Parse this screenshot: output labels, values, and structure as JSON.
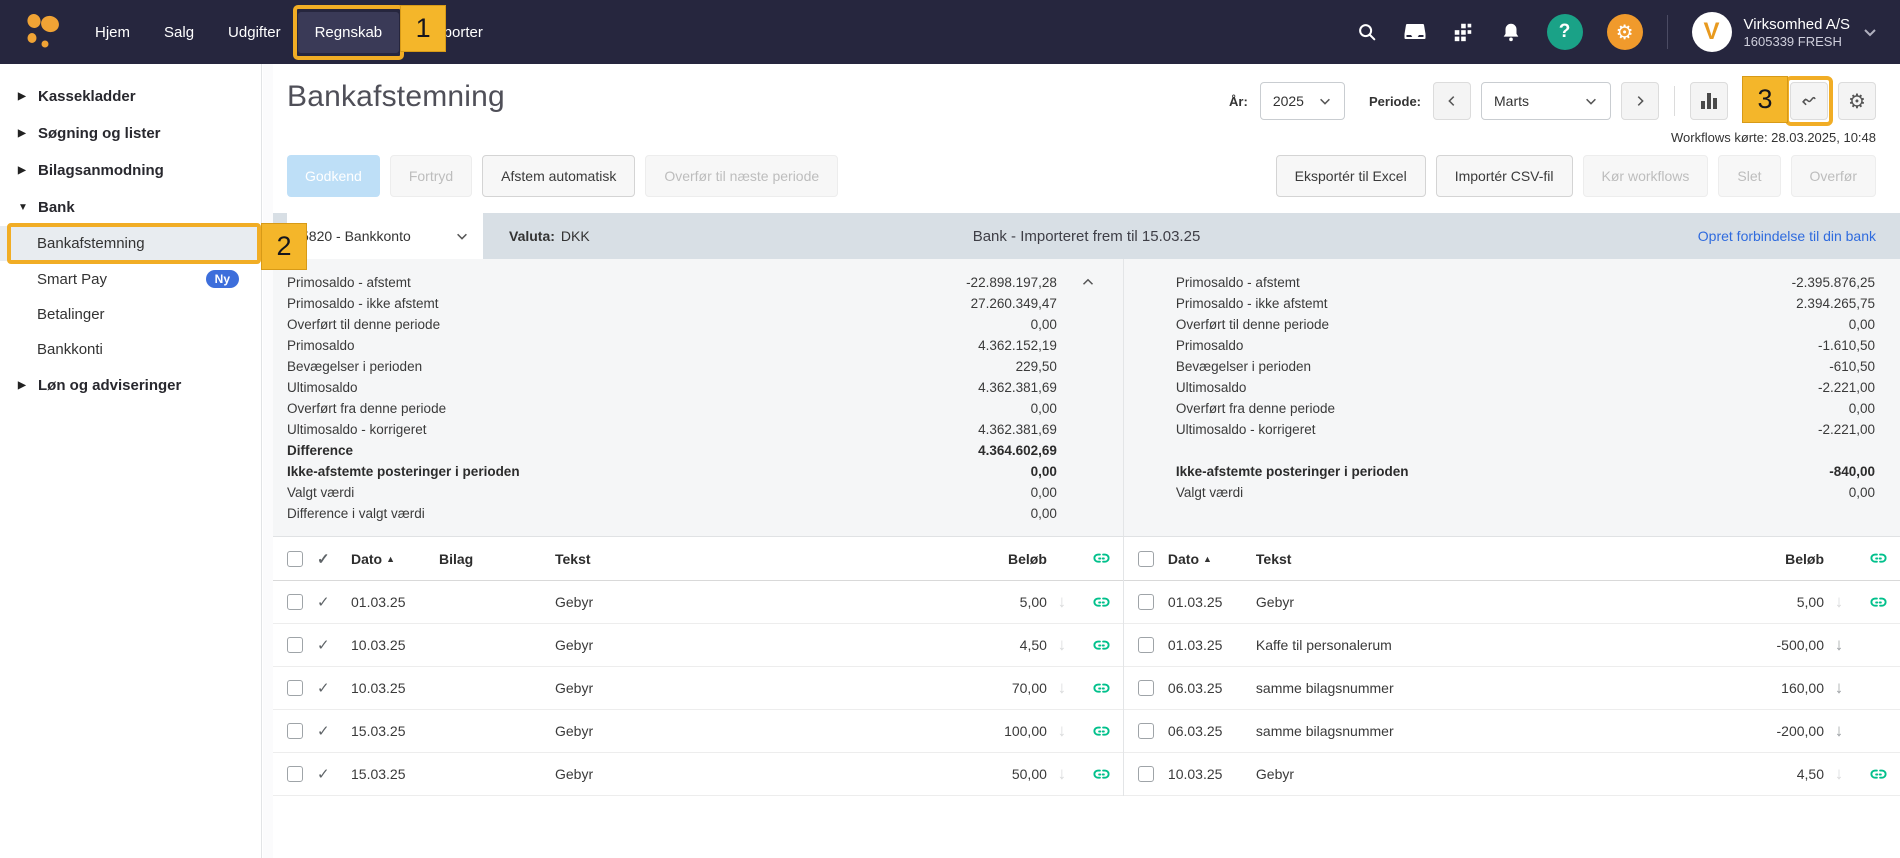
{
  "colors": {
    "topbar_bg": "#26263E",
    "accent_amber": "#F1AD25",
    "badge_fill": "#F4B62A",
    "help_green": "#1AA287",
    "settings_orange": "#F09A2C",
    "link_blue": "#2F6BDE",
    "chain_green": "#00C08B",
    "ny_badge_blue": "#3D6EDB",
    "bank_bar": "#D8DFE5",
    "primary_disabled_btn": "#BEDFF7"
  },
  "topbar": {
    "nav": [
      {
        "label": "Hjem"
      },
      {
        "label": "Salg"
      },
      {
        "label": "Udgifter"
      },
      {
        "label": "Regnskab",
        "active": true
      },
      {
        "label": "Rapporter"
      }
    ],
    "company_name": "Virksomhed A/S",
    "company_id": "1605339 FRESH",
    "avatar_letter": "V"
  },
  "annotations": {
    "badge1": "1",
    "badge2": "2",
    "badge3": "3"
  },
  "sidebar": {
    "sections": [
      {
        "label": "Kassekladder"
      },
      {
        "label": "Søgning og lister"
      },
      {
        "label": "Bilagsanmodning"
      },
      {
        "label": "Bank",
        "expanded": true
      },
      {
        "label": "Løn og adviseringer"
      }
    ],
    "bank_children": [
      {
        "label": "Bankafstemning",
        "selected": true
      },
      {
        "label": "Smart Pay",
        "badge": "Ny"
      },
      {
        "label": "Betalinger"
      },
      {
        "label": "Bankkonti"
      }
    ]
  },
  "header": {
    "title": "Bankafstemning",
    "year_label": "År:",
    "year_value": "2025",
    "period_label": "Periode:",
    "period_value": "Marts",
    "workflows_note": "Workflows kørte: 28.03.2025, 10:48"
  },
  "toolbar": {
    "left": [
      {
        "label": "Godkend",
        "state": "primary-disabled"
      },
      {
        "label": "Fortryd",
        "state": "disabled"
      },
      {
        "label": "Afstem automatisk",
        "state": "enabled"
      },
      {
        "label": "Overfør til næste periode",
        "state": "disabled"
      }
    ],
    "right": [
      {
        "label": "Eksportér til Excel",
        "state": "enabled"
      },
      {
        "label": "Importér CSV-fil",
        "state": "enabled"
      },
      {
        "label": "Kør workflows",
        "state": "disabled"
      },
      {
        "label": "Slet",
        "state": "disabled"
      },
      {
        "label": "Overfør",
        "state": "disabled"
      }
    ]
  },
  "bankbar": {
    "account_value": "5820 - Bankkonto",
    "currency_label": "Valuta:",
    "currency_value": "DKK",
    "status": "Bank - Importeret frem til 15.03.25",
    "connect_link": "Opret forbindelse til din bank"
  },
  "summary": {
    "left_rows": [
      {
        "label": "Primosaldo - afstemt",
        "value": "-22.898.197,28"
      },
      {
        "label": "Primosaldo - ikke afstemt",
        "value": "27.260.349,47"
      },
      {
        "label": "Overført til denne periode",
        "value": "0,00"
      },
      {
        "label": "Primosaldo",
        "value": "4.362.152,19"
      },
      {
        "label": "Bevægelser i perioden",
        "value": "229,50"
      },
      {
        "label": "Ultimosaldo",
        "value": "4.362.381,69"
      },
      {
        "label": "Overført fra denne periode",
        "value": "0,00"
      },
      {
        "label": "Ultimosaldo - korrigeret",
        "value": "4.362.381,69"
      },
      {
        "label": "Difference",
        "value": "4.364.602,69",
        "bold": true
      },
      {
        "label": "Ikke-afstemte posteringer i perioden",
        "value": "0,00",
        "bold": true
      },
      {
        "label": "Valgt værdi",
        "value": "0,00"
      },
      {
        "label": "Difference i valgt værdi",
        "value": "0,00"
      }
    ],
    "right_rows": [
      {
        "label": "Primosaldo - afstemt",
        "value": "-2.395.876,25"
      },
      {
        "label": "Primosaldo - ikke afstemt",
        "value": "2.394.265,75"
      },
      {
        "label": "Overført til denne periode",
        "value": "0,00"
      },
      {
        "label": "Primosaldo",
        "value": "-1.610,50"
      },
      {
        "label": "Bevægelser i perioden",
        "value": "-610,50"
      },
      {
        "label": "Ultimosaldo",
        "value": "-2.221,00"
      },
      {
        "label": "Overført fra denne periode",
        "value": "0,00"
      },
      {
        "label": "Ultimosaldo - korrigeret",
        "value": "-2.221,00"
      },
      {
        "spacer": true
      },
      {
        "label": "Ikke-afstemte posteringer i perioden",
        "value": "-840,00",
        "bold": true
      },
      {
        "label": "Valgt værdi",
        "value": "0,00"
      }
    ]
  },
  "tables": {
    "left": {
      "headers": {
        "dato": "Dato",
        "bilag": "Bilag",
        "tekst": "Tekst",
        "belob": "Beløb"
      },
      "rows": [
        {
          "date": "01.03.25",
          "bilag": "",
          "text": "Gebyr",
          "amount": "5,00",
          "reconciled": true,
          "arrow": "faded",
          "linked": true
        },
        {
          "date": "10.03.25",
          "bilag": "",
          "text": "Gebyr",
          "amount": "4,50",
          "reconciled": true,
          "arrow": "faded",
          "linked": true
        },
        {
          "date": "10.03.25",
          "bilag": "",
          "text": "Gebyr",
          "amount": "70,00",
          "reconciled": true,
          "arrow": "faded",
          "linked": true
        },
        {
          "date": "15.03.25",
          "bilag": "",
          "text": "Gebyr",
          "amount": "100,00",
          "reconciled": true,
          "arrow": "faded",
          "linked": true
        },
        {
          "date": "15.03.25",
          "bilag": "",
          "text": "Gebyr",
          "amount": "50,00",
          "reconciled": true,
          "arrow": "faded",
          "linked": true
        }
      ]
    },
    "right": {
      "headers": {
        "dato": "Dato",
        "tekst": "Tekst",
        "belob": "Beløb"
      },
      "rows": [
        {
          "date": "01.03.25",
          "text": "Gebyr",
          "amount": "5,00",
          "arrow": "faded",
          "linked": true
        },
        {
          "date": "01.03.25",
          "text": "Kaffe til personalerum",
          "amount": "-500,00",
          "arrow": "solid",
          "linked": false
        },
        {
          "date": "06.03.25",
          "text": "samme bilagsnummer",
          "amount": "160,00",
          "arrow": "solid",
          "linked": false
        },
        {
          "date": "06.03.25",
          "text": "samme bilagsnummer",
          "amount": "-200,00",
          "arrow": "solid",
          "linked": false
        },
        {
          "date": "10.03.25",
          "text": "Gebyr",
          "amount": "4,50",
          "arrow": "faded",
          "linked": true
        }
      ]
    }
  },
  "icons": {
    "help_glyph": "?",
    "gear_glyph": "⚙",
    "sort_asc_glyph": "▲",
    "check_glyph": "✓",
    "down_arrow_glyph": "↓",
    "tri_collapsed": "▶",
    "tri_expanded": "▼"
  }
}
